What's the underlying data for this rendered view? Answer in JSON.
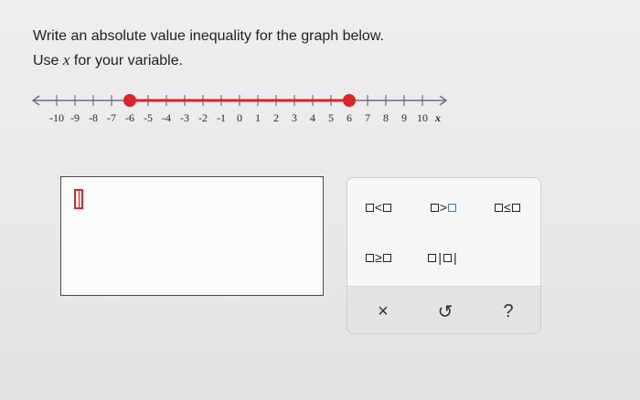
{
  "prompt": {
    "line1": "Write an absolute value inequality for the graph below.",
    "line2_prefix": "Use ",
    "variable": "x",
    "line2_suffix": " for your variable."
  },
  "number_line": {
    "min": -10,
    "max": 10,
    "tick_labels": [
      "-10",
      "-9",
      "-8",
      "-7",
      "-6",
      "-5",
      "-4",
      "-3",
      "-2",
      "-1",
      "0",
      "1",
      "2",
      "3",
      "4",
      "5",
      "6",
      "7",
      "8",
      "9",
      "10"
    ],
    "axis_variable": "x",
    "shaded_segment": {
      "from": -6,
      "to": 6,
      "endpoints": "closed"
    },
    "shade_color": "#d8262d",
    "axis_color": "#6b6f86"
  },
  "keypad": {
    "keys": [
      {
        "name": "less-than-key",
        "op": "<",
        "right_blue": false
      },
      {
        "name": "greater-than-key",
        "op": ">",
        "right_blue": true
      },
      {
        "name": "less-equal-key",
        "op": "≤",
        "right_blue": false
      },
      {
        "name": "greater-equal-key",
        "op": "≥",
        "right_blue": false
      },
      {
        "name": "absolute-value-key",
        "op": "|",
        "right_blue": false
      }
    ],
    "actions": {
      "clear": "×",
      "undo": "↺",
      "help": "?"
    }
  }
}
